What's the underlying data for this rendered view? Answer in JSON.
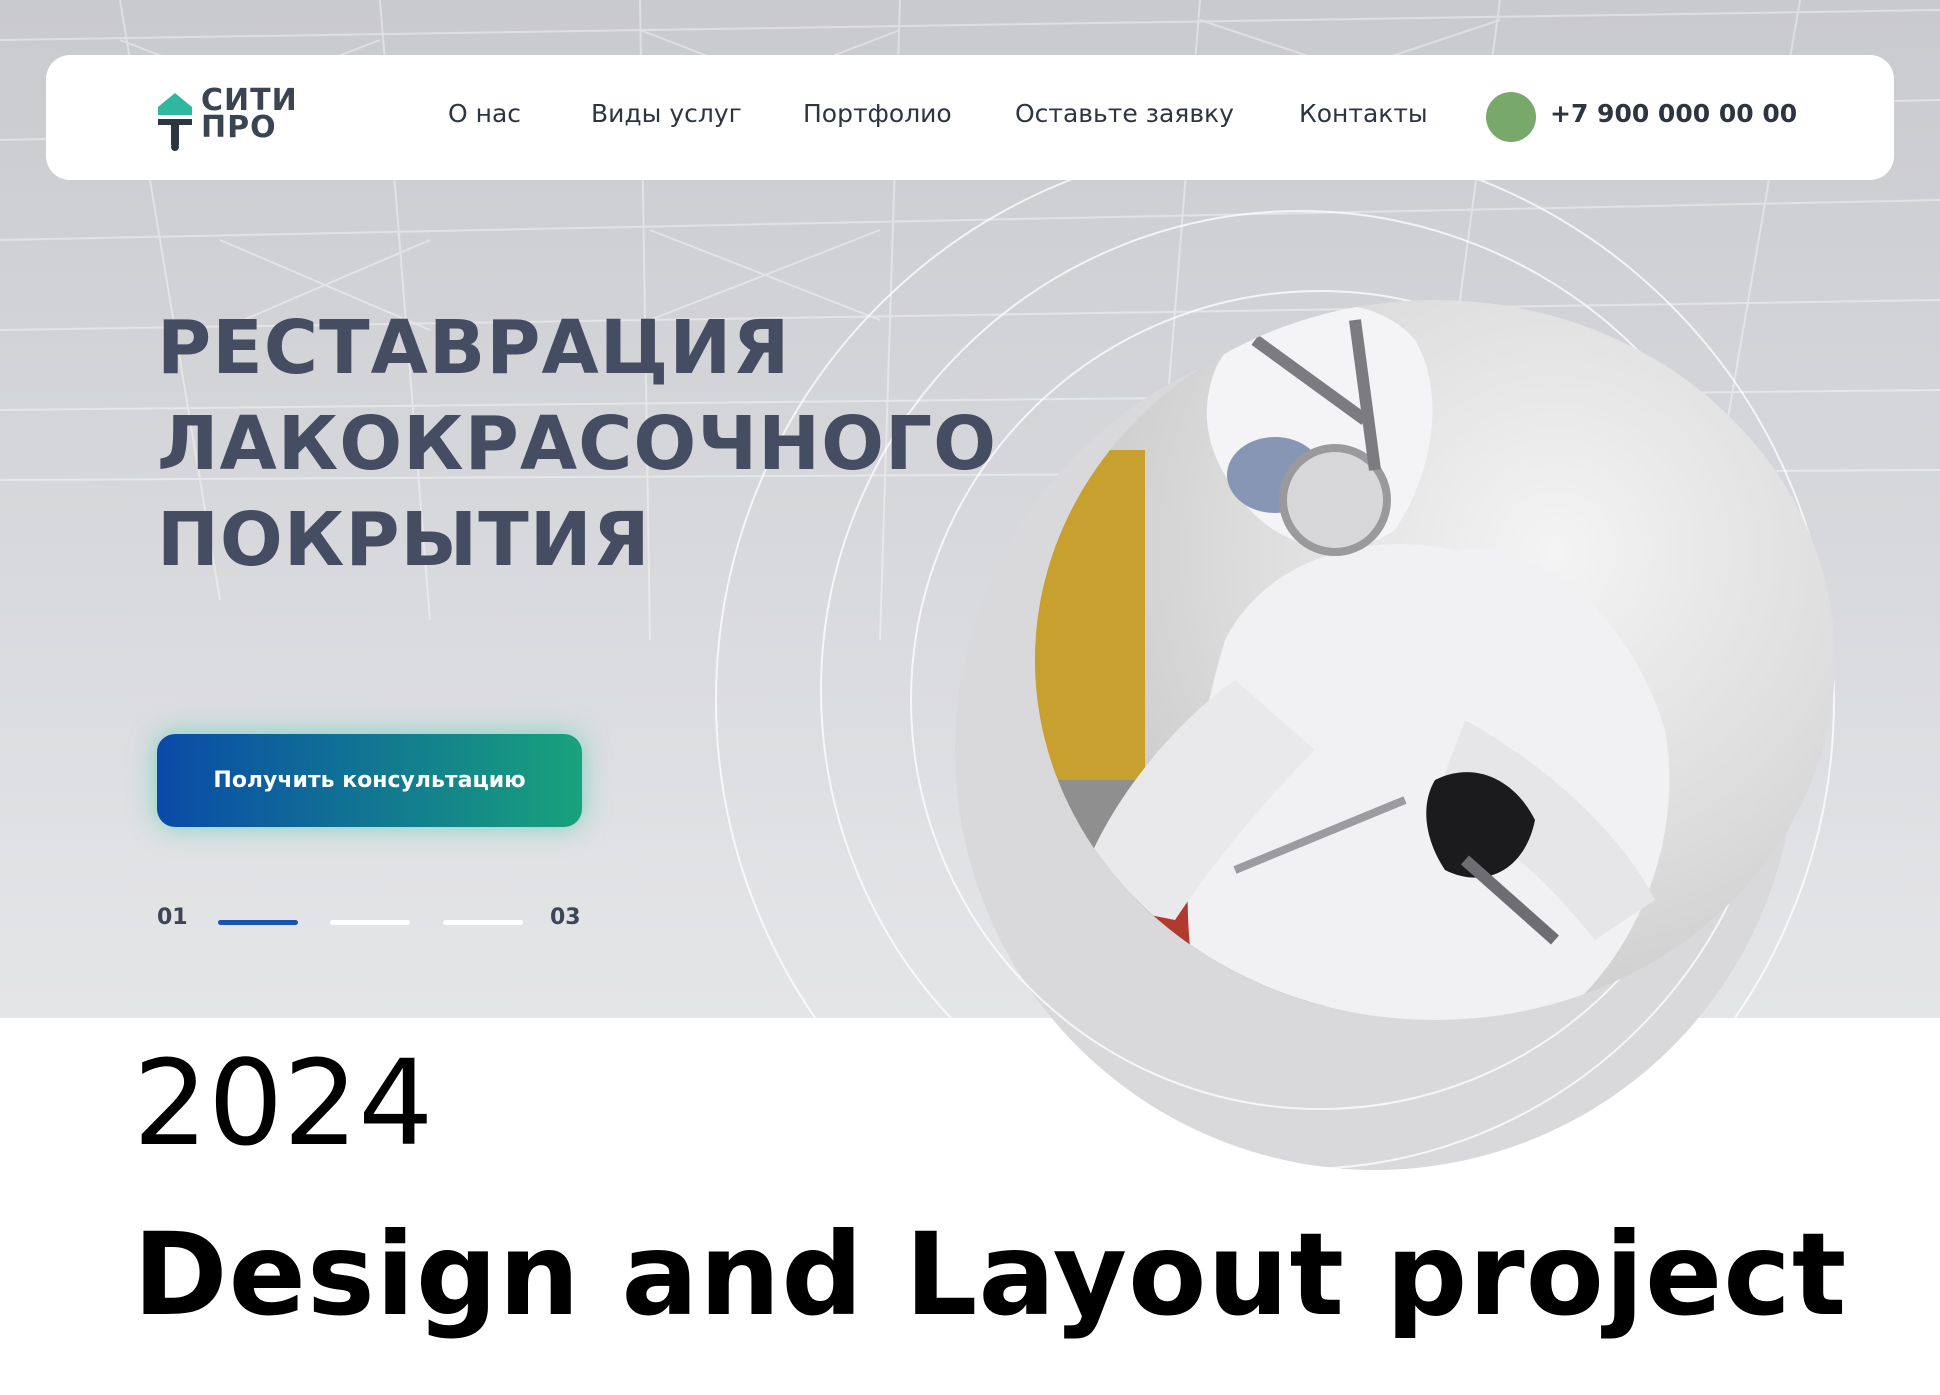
{
  "header": {
    "logo_line1": "СИТИ",
    "logo_line2": "ПРО",
    "nav": [
      "О нас",
      "Виды услуг",
      "Портфолио",
      "Оставьте заявку",
      "Контакты"
    ],
    "phone": "+7 900 000 00 00"
  },
  "hero": {
    "title_lines": [
      "РЕСТАВРАЦИЯ",
      "ЛАКОКРАСОЧНОГО",
      "ПОКРЫТИЯ"
    ],
    "cta_label": "Получить консультацию",
    "slider": {
      "first": "01",
      "last": "03",
      "current": 1,
      "total": 3
    }
  },
  "caption": {
    "year": "2024",
    "title": "Design and Layout project"
  },
  "colors": {
    "title_text": "#454d63",
    "cta_gradient_start": "#0a4aa8",
    "cta_gradient_end": "#18a27c",
    "phone_dot": "#79a86b",
    "slider_active": "#1a54b0"
  }
}
